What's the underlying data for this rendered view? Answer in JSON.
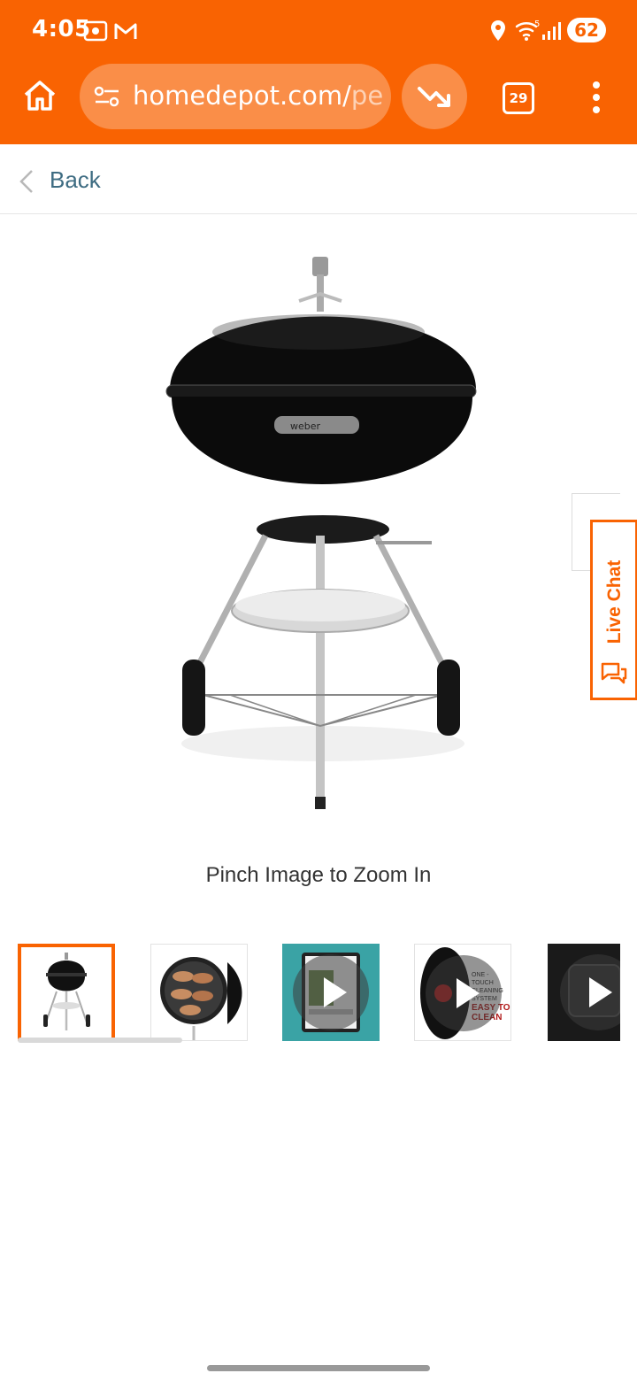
{
  "status_bar": {
    "time": "4:05",
    "battery": "62"
  },
  "browser": {
    "url_main": "homedepot.com/",
    "url_faded": "pep",
    "tab_count": "29"
  },
  "nav": {
    "back_label": "Back"
  },
  "product": {
    "zoom_hint": "Pinch Image to Zoom In"
  },
  "live_chat": {
    "label": "Live Chat"
  },
  "thumbnails": [
    {
      "kind": "image",
      "selected": true
    },
    {
      "kind": "image",
      "selected": false
    },
    {
      "kind": "video",
      "selected": false
    },
    {
      "kind": "video",
      "selected": false,
      "caption_lines": [
        "ONE - TOUCH",
        "CLEANING SYSTEM",
        "EASY TO",
        "CLEAN"
      ]
    },
    {
      "kind": "video",
      "selected": false
    }
  ],
  "colors": {
    "brand": "#f96302",
    "link": "#3e6c82"
  },
  "icons": [
    "home-icon",
    "site-settings-icon",
    "trending-down-icon",
    "tabs-icon",
    "more-vert-icon",
    "chevron-left-icon",
    "chat-icon",
    "play-icon",
    "location-icon",
    "wifi-icon",
    "signal-icon"
  ]
}
